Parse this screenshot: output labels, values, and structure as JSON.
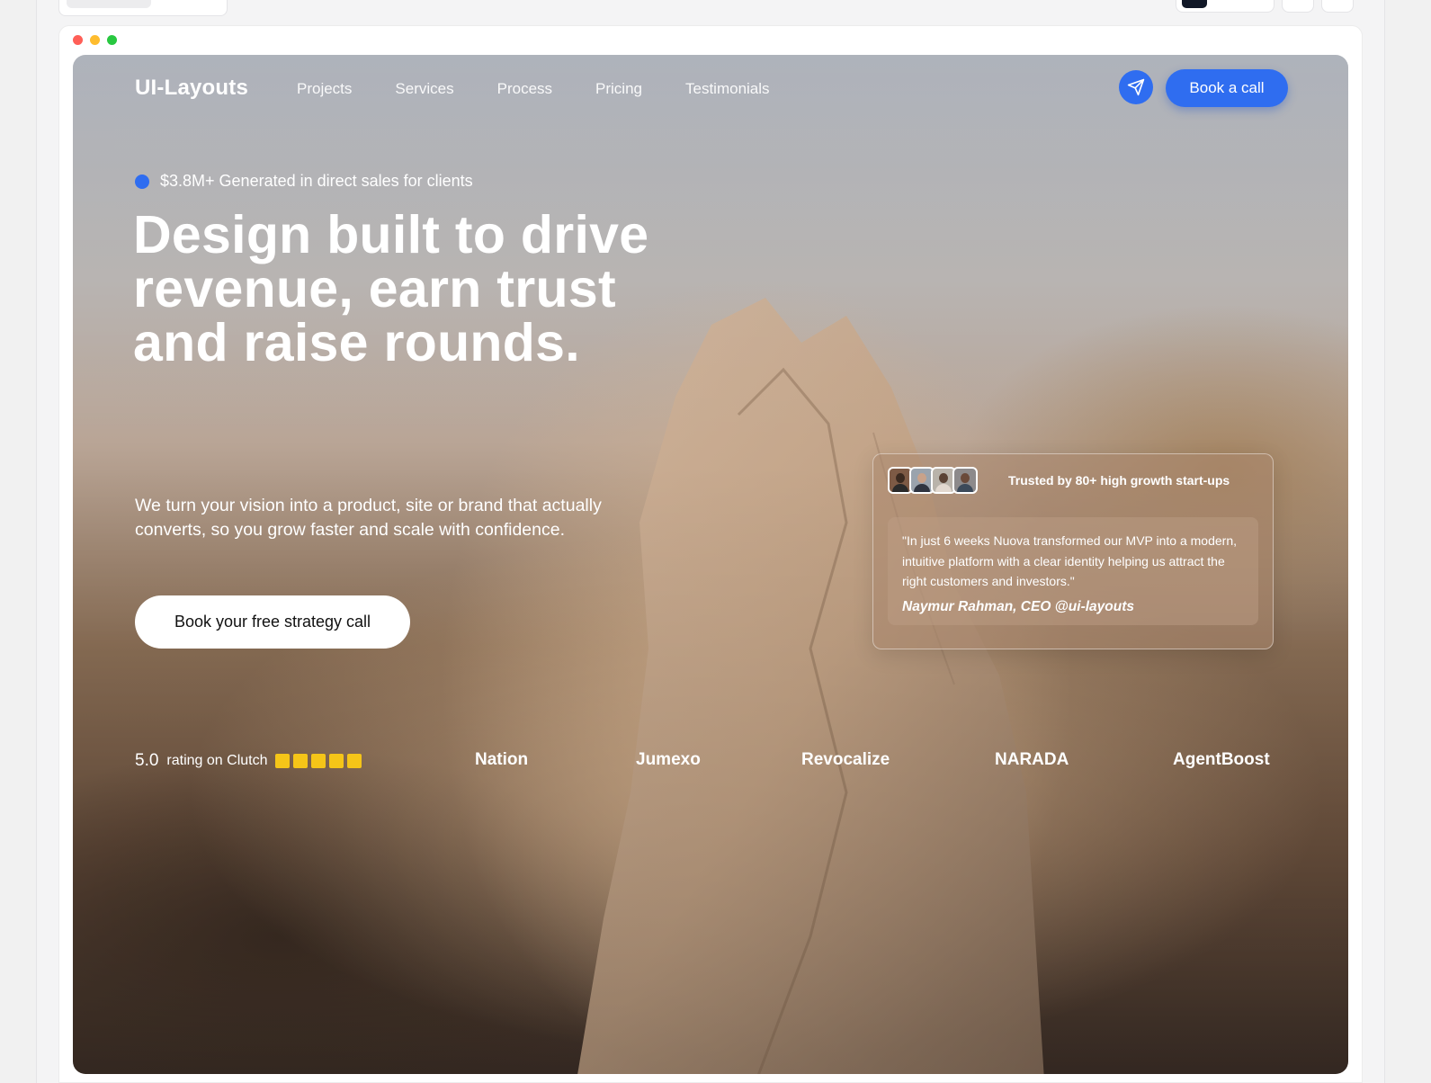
{
  "site": {
    "logo": "UI-Layouts",
    "nav": [
      "Projects",
      "Services",
      "Process",
      "Pricing",
      "Testimonials"
    ],
    "book_call_label": "Book a call",
    "send_icon": "paper-plane-icon"
  },
  "hero": {
    "tag": "$3.8M+ Generated in direct sales for clients",
    "headline": [
      "Design built to drive",
      "revenue, earn trust",
      "and raise rounds."
    ],
    "subtext": "We turn your vision into a product, site or brand that actually converts, so you grow faster and scale with confidence.",
    "cta_label": "Book your free strategy call"
  },
  "testimonial": {
    "trusted": "Trusted by 80+ high growth start-ups",
    "quote": "\"In just 6 weeks Nuova transformed our MVP into a modern, intuitive platform with a clear identity helping us attract the right customers and investors.\"",
    "author": "Naymur Rahman, CEO @ui-layouts"
  },
  "rating": {
    "score": "5.0",
    "label": "rating on Clutch",
    "stars": 5
  },
  "brands": [
    "Nation",
    "Jumexo",
    "Revocalize",
    "NARADA",
    "AgentBoost"
  ],
  "colors": {
    "accent": "#2f6df0",
    "star": "#f5c518"
  }
}
